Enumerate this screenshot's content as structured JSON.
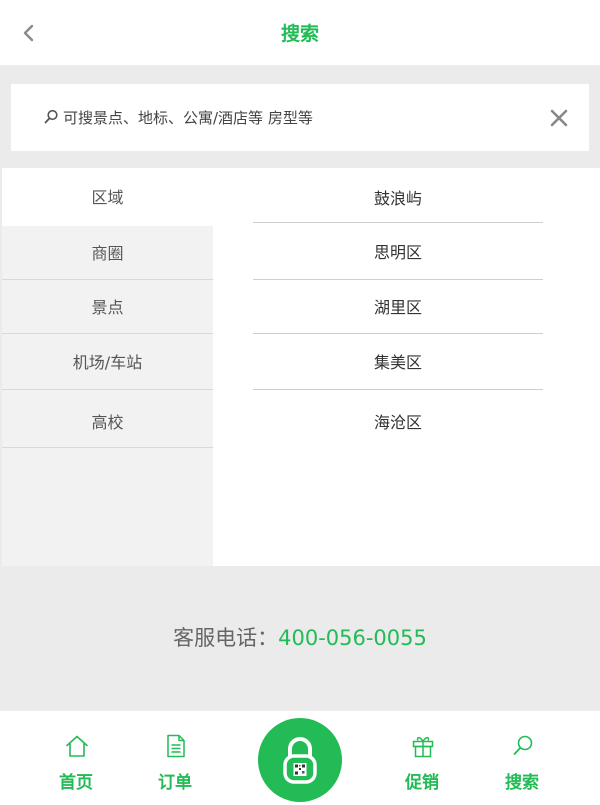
{
  "header": {
    "title": "搜索",
    "back_icon": "chevron-left-icon"
  },
  "search": {
    "placeholder": "可搜景点、地标、公寓/酒店等 房型等",
    "value": "",
    "icon": "search-icon",
    "clear_icon": "close-icon"
  },
  "categories": [
    {
      "label": "区域",
      "active": true
    },
    {
      "label": "商圈",
      "active": false
    },
    {
      "label": "景点",
      "active": false
    },
    {
      "label": "机场/车站",
      "active": false
    },
    {
      "label": "高校",
      "active": false
    }
  ],
  "districts": [
    {
      "label": "鼓浪屿"
    },
    {
      "label": "思明区"
    },
    {
      "label": "湖里区"
    },
    {
      "label": "集美区"
    },
    {
      "label": "海沧区"
    }
  ],
  "service": {
    "label": "客服电话：",
    "phone": "400-056-0055"
  },
  "tabbar": {
    "items": [
      {
        "label": "首页",
        "icon": "home-icon"
      },
      {
        "label": "订单",
        "icon": "document-icon"
      },
      {
        "label": "",
        "icon": "lock-icon"
      },
      {
        "label": "促销",
        "icon": "gift-icon"
      },
      {
        "label": "搜索",
        "icon": "search-icon"
      }
    ]
  },
  "colors": {
    "accent": "#22bb55",
    "page_background": "#ebebeb",
    "sidebar_background": "#f2f2f2",
    "text": "#333333"
  }
}
